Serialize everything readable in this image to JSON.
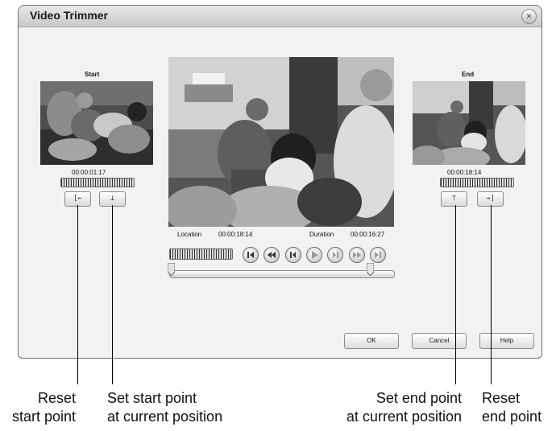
{
  "window": {
    "title": "Video Trimmer",
    "close_glyph": "×"
  },
  "start_panel": {
    "label": "Start",
    "timecode": "00:00:01:17",
    "reset_button_glyph": "[←",
    "set_button_glyph": "⊥"
  },
  "end_panel": {
    "label": "End",
    "timecode": "00:00:18:14",
    "set_button_glyph": "⊤",
    "reset_button_glyph": "→]"
  },
  "player": {
    "location_label": "Location",
    "location_value": "00:00:18:14",
    "duration_label": "Duration",
    "duration_value": "00:00:16:27",
    "controls": [
      "go-to-start-icon",
      "rewind-icon",
      "step-back-icon",
      "play-icon",
      "step-forward-icon",
      "fast-forward-icon",
      "go-to-end-icon"
    ]
  },
  "dialog_buttons": {
    "ok": "OK",
    "cancel": "Cancel",
    "help": "Help"
  },
  "callouts": {
    "reset_start": "Reset\nstart point",
    "set_start": "Set start point\nat current position",
    "set_end": "Set end point\nat current position",
    "reset_end": "Reset\nend point"
  }
}
